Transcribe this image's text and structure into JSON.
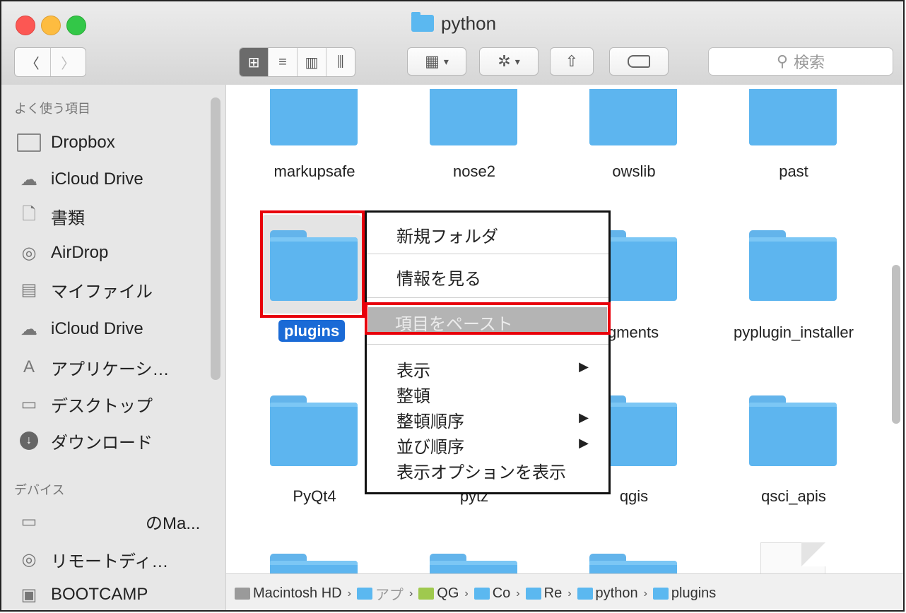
{
  "window": {
    "title": "python"
  },
  "toolbar": {
    "back_icon": "chevron-left",
    "forward_icon": "chevron-right",
    "view_icons": [
      "grid-icon",
      "list-icon",
      "columns-icon",
      "coverflow-icon"
    ],
    "search_placeholder": "検索"
  },
  "sidebar": {
    "favorites_header": "よく使う項目",
    "favorites": [
      {
        "label": "Dropbox",
        "icon": "folder-icon"
      },
      {
        "label": "iCloud Drive",
        "icon": "cloud-icon"
      },
      {
        "label": "書類",
        "icon": "documents-icon"
      },
      {
        "label": "AirDrop",
        "icon": "airdrop-icon"
      },
      {
        "label": "マイファイル",
        "icon": "all-files-icon"
      },
      {
        "label": "iCloud Drive",
        "icon": "cloud-icon"
      },
      {
        "label": "アプリケーシ…",
        "icon": "applications-icon"
      },
      {
        "label": "デスクトップ",
        "icon": "desktop-icon"
      },
      {
        "label": "ダウンロード",
        "icon": "download-icon"
      }
    ],
    "devices_header": "デバイス",
    "devices": [
      {
        "label": "のMa...",
        "icon": "laptop-icon"
      },
      {
        "label": "リモートディ…",
        "icon": "disc-icon"
      },
      {
        "label": "BOOTCAMP",
        "icon": "drive-icon"
      }
    ]
  },
  "files": {
    "row1": [
      "markupsafe",
      "nose2",
      "owslib",
      "past"
    ],
    "row2": [
      "plugins",
      "",
      "gments",
      "pyplugin_installer"
    ],
    "row3": [
      "PyQt4",
      "pytz",
      "qgis",
      "qsci_apis"
    ]
  },
  "context_menu": {
    "new_folder": "新規フォルダ",
    "get_info": "情報を見る",
    "paste_item": "項目をペースト",
    "view": "表示",
    "clean_up": "整頓",
    "clean_up_by": "整頓順序",
    "sort_by": "並び順序",
    "show_view_options": "表示オプションを表示",
    "submenu_arrow": "▶"
  },
  "pathbar": {
    "items": [
      "Macintosh HD",
      "アプ",
      "QG",
      "Co",
      "Re",
      "python",
      "plugins"
    ],
    "separator": "›"
  },
  "colors": {
    "folder_blue": "#5db5ef",
    "selection_blue": "#1a6ad6",
    "highlight_red": "#e8000b"
  }
}
